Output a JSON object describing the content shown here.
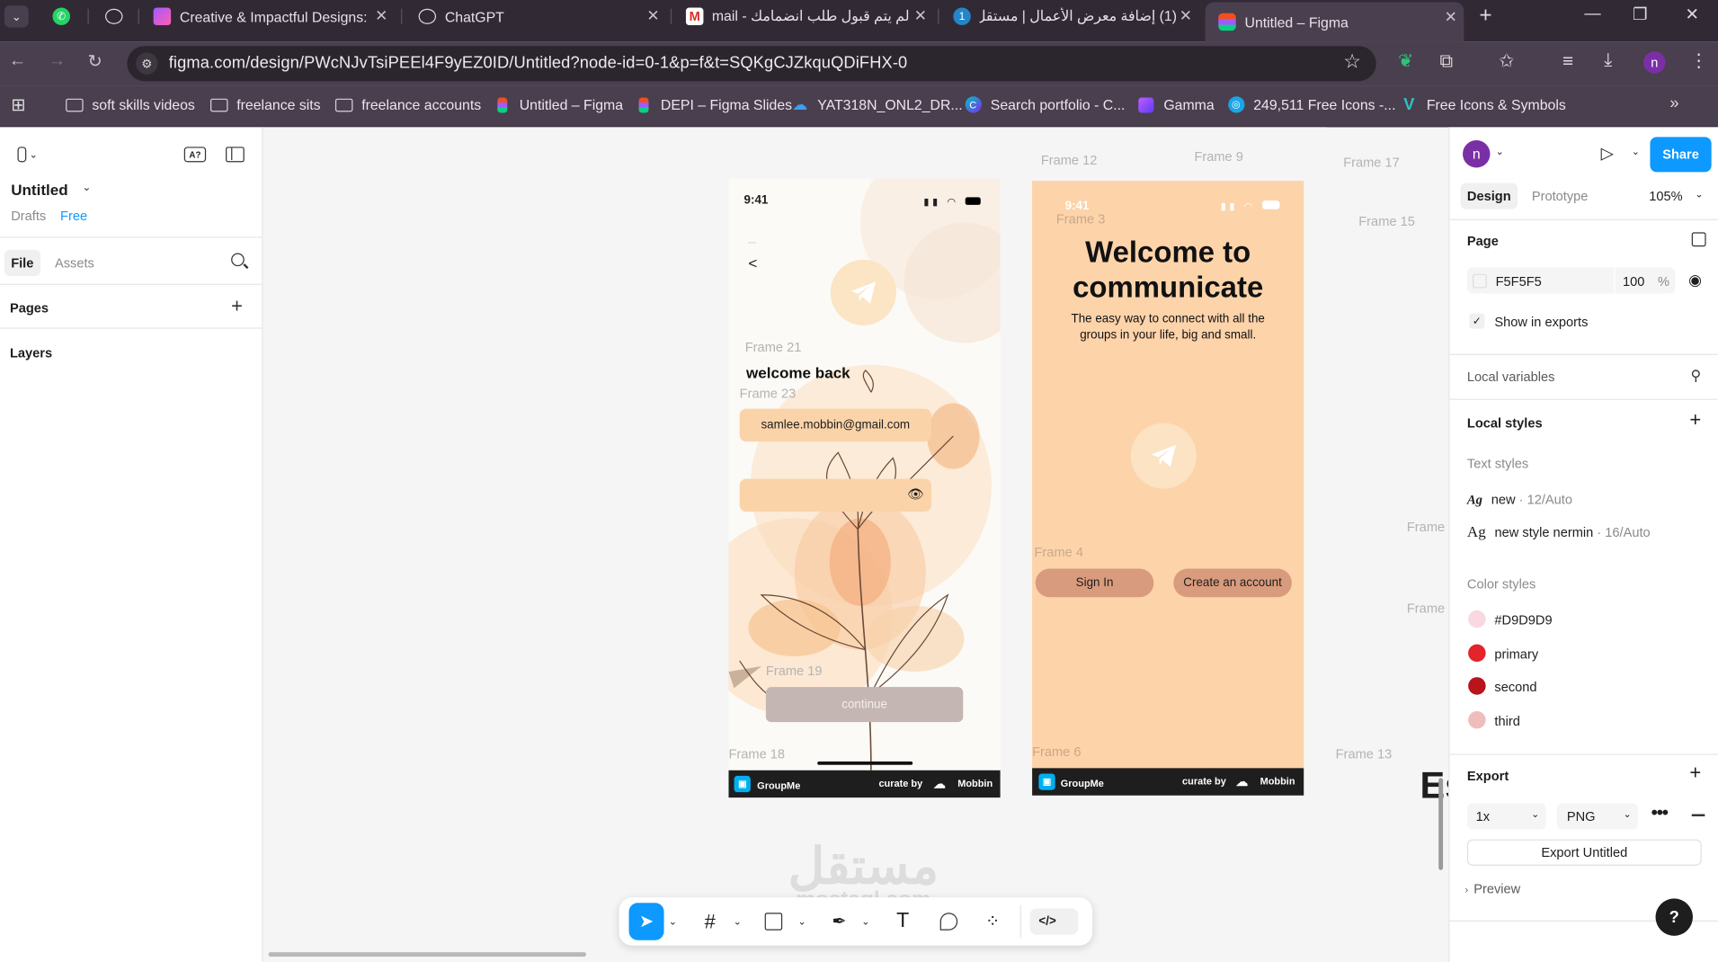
{
  "browser": {
    "tabs": [
      {
        "title": "",
        "icon": "whatsapp-icon"
      },
      {
        "title": "",
        "icon": "openai-icon"
      },
      {
        "title": "Creative & Impactful Designs: E",
        "icon": "figma-slides-icon"
      },
      {
        "title": "ChatGPT",
        "icon": "openai-icon"
      },
      {
        "title": "لم يتم قبول طلب انضمامك - mail",
        "icon": "gmail-icon"
      },
      {
        "title": "(1) إضافة معرض الأعمال | مستقل",
        "icon": "mostaql-icon"
      },
      {
        "title": "Untitled – Figma",
        "icon": "figma-icon",
        "active": true
      }
    ],
    "url": "figma.com/design/PWcNJvTsiPEEl4F9yEZ0ID/Untitled?node-id=0-1&p=f&t=SQKgCJZkquQDiFHX-0",
    "profile_initial": "n",
    "bookmarks": [
      {
        "label": "soft skills videos",
        "icon": "folder-icon"
      },
      {
        "label": "freelance sits",
        "icon": "folder-icon"
      },
      {
        "label": "freelance accounts",
        "icon": "folder-icon"
      },
      {
        "label": "Untitled – Figma",
        "icon": "figma-icon"
      },
      {
        "label": "DEPI – Figma Slides",
        "icon": "figma-icon"
      },
      {
        "label": "YAT318N_ONL2_DR...",
        "icon": "cloud-icon"
      },
      {
        "label": "Search portfolio - C...",
        "icon": "canva-icon"
      },
      {
        "label": "Gamma",
        "icon": "gamma-icon"
      },
      {
        "label": "249,511 Free Icons -...",
        "icon": "search-icon"
      },
      {
        "label": "Free Icons & Symbols",
        "icon": "vector-icon"
      }
    ]
  },
  "left_panel": {
    "file_name": "Untitled",
    "location": "Drafts",
    "plan": "Free",
    "tabs": [
      "File",
      "Assets"
    ],
    "pages_label": "Pages",
    "layers_label": "Layers"
  },
  "canvas": {
    "frame_labels": {
      "f12": "Frame 12",
      "f9": "Frame 9",
      "f17": "Frame 17",
      "f15": "Frame 15",
      "f21": "Frame 21",
      "f23": "Frame 23",
      "f19": "Frame 19",
      "f18": "Frame 18",
      "f3": "Frame 3",
      "f4": "Frame 4",
      "f6": "Frame 6",
      "f13": "Frame 13",
      "fa": "Frame",
      "fb": "Frame"
    },
    "login_screen": {
      "time": "9:41",
      "back": "<",
      "dots": "...",
      "title": "welcome back",
      "email": "samlee.mobbin@gmail.com",
      "continue": "continue",
      "footer_brand": "GroupMe",
      "footer_curate": "curate by",
      "footer_mobbin": "Mobbin"
    },
    "welcome_screen": {
      "time": "9:41",
      "title_line1": "Welcome to",
      "title_line2": "communicate",
      "subtitle_line1": "The easy way to connect with all the",
      "subtitle_line2": "groups in your life, big and small.",
      "signin": "Sign In",
      "create": "Create an account",
      "footer_brand": "GroupMe",
      "footer_curate": "curate by",
      "footer_mobbin": "Mobbin"
    },
    "edge_text": "Es",
    "watermark_main": "مستقل",
    "watermark_sub": "mostaql.com"
  },
  "right_panel": {
    "avatar_initial": "n",
    "share_label": "Share",
    "tabs": [
      "Design",
      "Prototype"
    ],
    "zoom": "105%",
    "page_label": "Page",
    "page_color": "F5F5F5",
    "page_opacity": "100",
    "percent": "%",
    "show_in_exports": "Show in exports",
    "local_variables": "Local variables",
    "local_styles": "Local styles",
    "text_styles_label": "Text styles",
    "text_styles": [
      {
        "name": "new",
        "meta": " · 12/Auto"
      },
      {
        "name": "new style nermin",
        "meta": " · 16/Auto"
      }
    ],
    "color_styles_label": "Color styles",
    "color_styles": [
      {
        "name": "#D9D9D9",
        "color": "#f9d8df"
      },
      {
        "name": "primary",
        "color": "#e3242b"
      },
      {
        "name": "second",
        "color": "#b8141a"
      },
      {
        "name": "third",
        "color": "#f0bdbd"
      }
    ],
    "export_label": "Export",
    "export_scale": "1x",
    "export_format": "PNG",
    "export_button": "Export Untitled",
    "preview_label": "Preview",
    "help": "?"
  },
  "colors": {
    "figma_blue": "#0d99ff",
    "peach": "#fdd4aa",
    "button_brown": "#d89c7d"
  }
}
